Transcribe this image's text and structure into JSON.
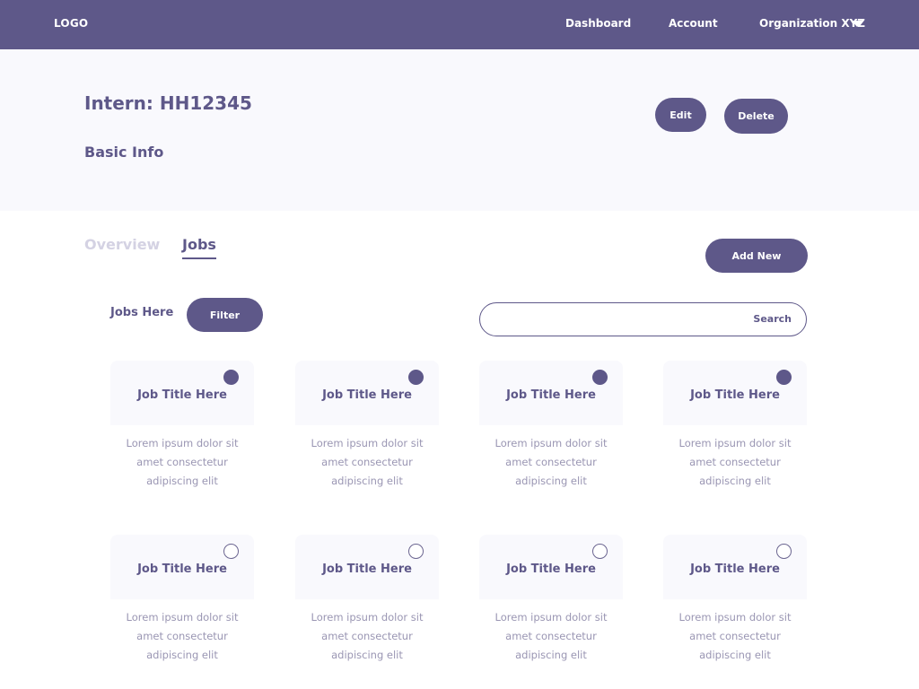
{
  "topnav": {
    "logo": "LOGO",
    "links": {
      "dashboard": "Dashboard",
      "account": "Account",
      "organization": "Organization XYZ"
    }
  },
  "header": {
    "title": "Intern: HH12345",
    "section": "Basic Info",
    "edit_label": "Edit",
    "delete_label": "Delete"
  },
  "tabs": {
    "overview": "Overview",
    "jobs": "Jobs",
    "active": "Jobs"
  },
  "actions": {
    "add_new_label": "Add New"
  },
  "jobs_toolbar": {
    "label": "Jobs Here",
    "filter_label": "Filter",
    "search_value": "",
    "search_label": "Search"
  },
  "job_cards": [
    {
      "title": "Job Title Here",
      "desc1": "Lorem ipsum dolor sit",
      "desc2": "amet consectetur",
      "desc3": "adipiscing elit",
      "selected": true
    },
    {
      "title": "Job Title Here",
      "desc1": "Lorem ipsum dolor sit",
      "desc2": "amet consectetur",
      "desc3": "adipiscing elit",
      "selected": true
    },
    {
      "title": "Job Title Here",
      "desc1": "Lorem ipsum dolor sit",
      "desc2": "amet consectetur",
      "desc3": "adipiscing elit",
      "selected": true
    },
    {
      "title": "Job Title Here",
      "desc1": "Lorem ipsum dolor sit",
      "desc2": "amet consectetur",
      "desc3": "adipiscing elit",
      "selected": true
    },
    {
      "title": "Job Title Here",
      "desc1": "Lorem ipsum dolor sit",
      "desc2": "amet consectetur",
      "desc3": "adipiscing elit",
      "selected": false
    },
    {
      "title": "Job Title Here",
      "desc1": "Lorem ipsum dolor sit",
      "desc2": "amet consectetur",
      "desc3": "adipiscing elit",
      "selected": false
    },
    {
      "title": "Job Title Here",
      "desc1": "Lorem ipsum dolor sit",
      "desc2": "amet consectetur",
      "desc3": "adipiscing elit",
      "selected": false
    },
    {
      "title": "Job Title Here",
      "desc1": "Lorem ipsum dolor sit",
      "desc2": "amet consectetur",
      "desc3": "adipiscing elit",
      "selected": false
    }
  ],
  "colors": {
    "brand": "#5e5889",
    "header_bg": "#f9f9fd",
    "muted_text": "#9a96b3",
    "inactive_tab": "#d4d2e3"
  }
}
